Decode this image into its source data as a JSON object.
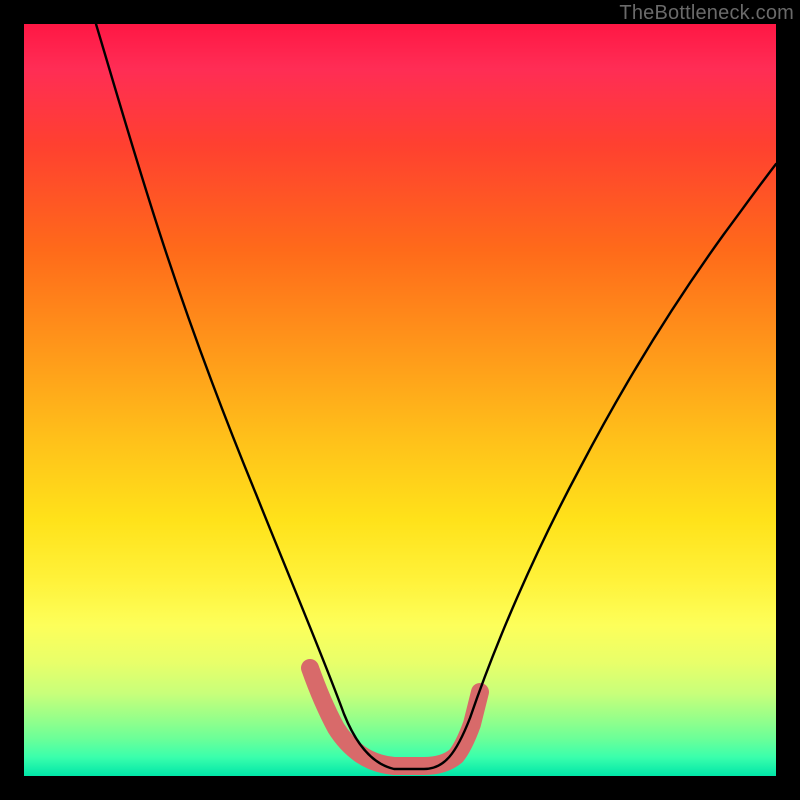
{
  "watermark": {
    "text": "TheBottleneck.com"
  },
  "chart_data": {
    "type": "line",
    "title": "",
    "xlabel": "",
    "ylabel": "",
    "xlim": [
      0,
      100
    ],
    "ylim": [
      0,
      100
    ],
    "series": [
      {
        "name": "bottleneck-curve",
        "x": [
          0,
          5,
          10,
          15,
          20,
          25,
          30,
          35,
          38,
          40,
          42,
          45,
          48,
          50,
          52,
          55,
          60,
          65,
          70,
          75,
          80,
          85,
          90,
          95,
          100
        ],
        "y": [
          100,
          88,
          76,
          64,
          52,
          40,
          28,
          18,
          10,
          5,
          2,
          0,
          0,
          0,
          0,
          2,
          8,
          15,
          22,
          30,
          38,
          46,
          54,
          62,
          70
        ]
      }
    ],
    "highlight": {
      "name": "optimal-band",
      "x_range": [
        38,
        55
      ],
      "color": "#d86a6a"
    },
    "gradient_stops": [
      {
        "pos": 0,
        "color": "#ff1744"
      },
      {
        "pos": 50,
        "color": "#ffe21a"
      },
      {
        "pos": 100,
        "color": "#00e6a8"
      }
    ]
  }
}
